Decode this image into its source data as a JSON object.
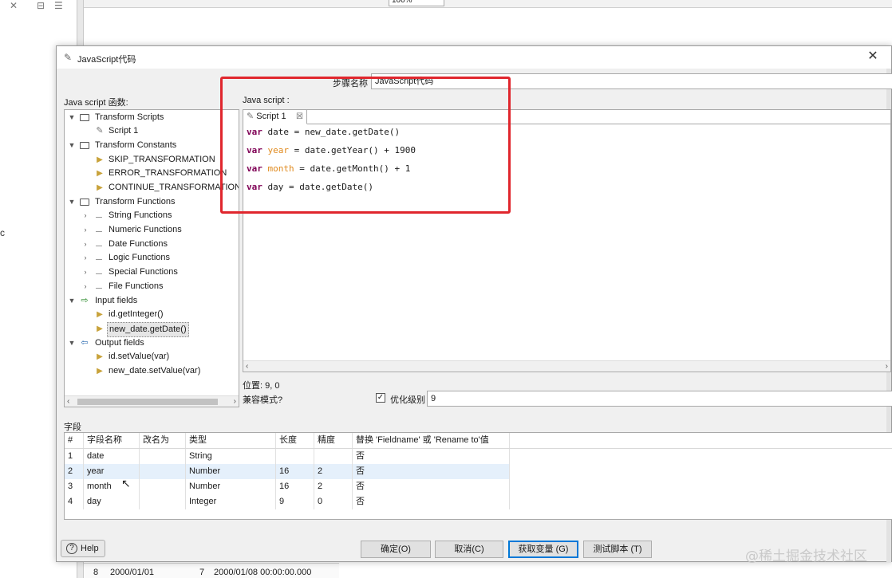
{
  "background": {
    "zoom": "100%",
    "stray_char": "c",
    "grid_row": {
      "num": "8",
      "date": "2000/01/01",
      "value": "7",
      "datetime": "2000/01/08 00:00:00.000"
    }
  },
  "dialog": {
    "title": "JavaScript代码",
    "step_name_label": "步骤名称",
    "step_name_value": "JavaScript代码",
    "functions_label": "Java script 函数:",
    "script_label": "Java script :",
    "tree": {
      "transform_scripts": "Transform Scripts",
      "script1": "Script 1",
      "transform_constants": "Transform Constants",
      "skip": "SKIP_TRANSFORMATION",
      "error": "ERROR_TRANSFORMATION",
      "continue": "CONTINUE_TRANSFORMATION",
      "transform_functions": "Transform Functions",
      "string_functions": "String Functions",
      "numeric_functions": "Numeric Functions",
      "date_functions": "Date Functions",
      "logic_functions": "Logic Functions",
      "special_functions": "Special Functions",
      "file_functions": "File Functions",
      "input_fields": "Input fields",
      "input_id": "id.getInteger()",
      "input_new_date": "new_date.getDate()",
      "output_fields": "Output fields",
      "output_id": "id.setValue(var)",
      "output_new_date": "new_date.setValue(var)"
    },
    "editor": {
      "tab_label": "Script 1",
      "lines": [
        {
          "kw": "var",
          "name": "date",
          "name_orange": false,
          "rest": " = new_date.getDate()"
        },
        {
          "kw": "var",
          "name": "year",
          "name_orange": true,
          "rest": " = date.getYear() + 1900"
        },
        {
          "kw": "var",
          "name": "month",
          "name_orange": true,
          "rest": " = date.getMonth() + 1"
        },
        {
          "kw": "var",
          "name": "day",
          "name_orange": false,
          "rest": " = date.getDate()"
        }
      ]
    },
    "position": "位置: 9, 0",
    "compat_mode": "兼容模式?",
    "optimization_label": "优化级别",
    "optimization_value": "9",
    "fields_label": "字段",
    "table": {
      "headers": [
        "#",
        "字段名称",
        "改名为",
        "类型",
        "长度",
        "精度",
        "替换 'Fieldname' 或 'Rename to'值"
      ],
      "rows": [
        [
          "1",
          "date",
          "",
          "String",
          "",
          "",
          "否"
        ],
        [
          "2",
          "year",
          "",
          "Number",
          "16",
          "2",
          "否"
        ],
        [
          "3",
          "month",
          "",
          "Number",
          "16",
          "2",
          "否"
        ],
        [
          "4",
          "day",
          "",
          "Integer",
          "9",
          "0",
          "否"
        ]
      ]
    },
    "buttons": {
      "help": "Help",
      "ok": "确定(O)",
      "cancel": "取消(C)",
      "get_variables": "获取变量 (G)",
      "test_script": "测试脚本 (T)"
    }
  },
  "watermark": "@稀土掘金技术社区",
  "colors": {
    "highlight_box": "#e0262d",
    "keyword": "#7f0055",
    "variable_orange": "#e08a1e",
    "selected_row": "#e5f0fb"
  }
}
